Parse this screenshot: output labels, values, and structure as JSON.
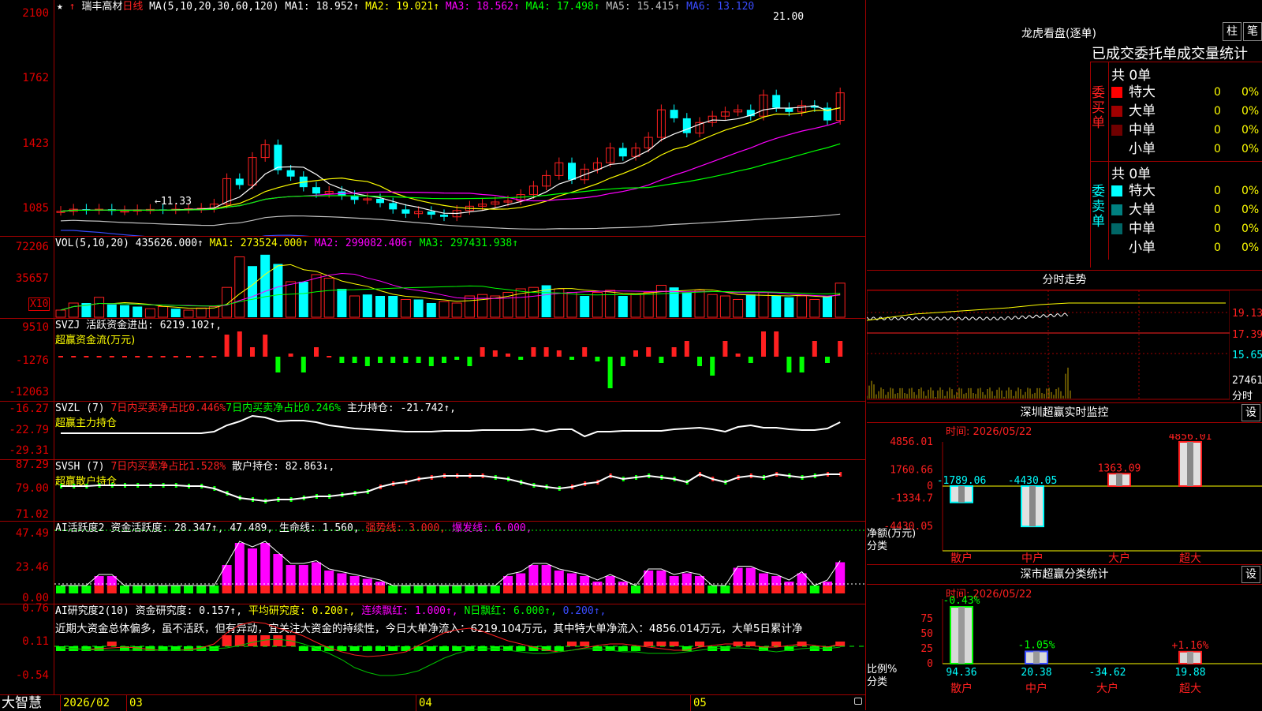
{
  "main": {
    "title": "瑞丰高材",
    "period": "日线",
    "ma_params": "MA(5,10,20,30,60,120)",
    "ma": [
      {
        "label": "MA1: 18.952↑",
        "color": "#ffffff"
      },
      {
        "label": "MA2: 19.021↑",
        "color": "#ffff00"
      },
      {
        "label": "MA3: 18.562↑",
        "color": "#ff00ff"
      },
      {
        "label": "MA4: 17.498↑",
        "color": "#00ff00"
      },
      {
        "label": "MA5: 15.415↑",
        "color": "#c0c0c0"
      },
      {
        "label": "MA6: 13.120",
        "color": "#3a4cff"
      }
    ],
    "y_ticks": [
      "2100",
      "1762",
      "1423",
      "1085"
    ],
    "high_label": "21.00",
    "low_label": "←11.33"
  },
  "vol": {
    "header": "VOL(5,10,20)",
    "value": "435626.000↑",
    "ma1": "MA1: 273524.000↑",
    "ma2": "MA2: 299082.406↑",
    "ma3": "MA3: 297431.938↑",
    "y_ticks": [
      "72206",
      "35657"
    ],
    "unit": "X10"
  },
  "svzj": {
    "header": "SVZJ  活跃资金进出: 6219.102↑,",
    "sub": "超赢资金流(万元)",
    "y_ticks": [
      "9510",
      "-1276",
      "-12063"
    ]
  },
  "svzl": {
    "name": "SVZL (7)",
    "a": "7日内买卖净占比0.446%",
    "b": "7日内买卖净占比0.246%",
    "c": "主力持仓: -21.742↑,",
    "sub": "超赢主力持仓",
    "y_ticks": [
      "-16.27",
      "-22.79",
      "-29.31"
    ]
  },
  "svsh": {
    "name": "SVSH (7)",
    "a": "7日内买卖净占比1.528%",
    "c": "散户持仓: 82.863↓,",
    "sub": "超赢散户持仓",
    "y_ticks": [
      "87.29",
      "79.00",
      "71.02"
    ]
  },
  "ai": {
    "name": "AI活跃度2",
    "a": "资金活跃度: 28.347↑,",
    "b": "47.489,",
    "c": "生命线: 1.560,",
    "d": "强势线: 3.000,",
    "e": "爆发线: 6.000,",
    "y_ticks": [
      "47.49",
      "23.46",
      "0.00"
    ]
  },
  "res": {
    "name": "AI研究度2(10)",
    "a": "资金研究度: 0.157↑,",
    "b": "平均研究度: 0.200↑,",
    "c": "连续飘红: 1.000↑,",
    "d": "N日飘红: 6.000↑,",
    "e": "0.200↑,",
    "text": "近期大资金总体偏多，虽不活跃，但有异动，宜关注大资金的持续性，今日大单净流入：6219.104万元，其中特大单净流入：4856.014万元，大单5日累计净",
    "y_ticks": [
      "0.76",
      "0.11",
      "-0.54"
    ]
  },
  "bottom": {
    "brand": "大智慧",
    "dates": [
      "2026/02",
      "03",
      "04",
      "05"
    ]
  },
  "right": {
    "title": "龙虎看盘(逐单)",
    "btn1": "柱",
    "btn2": "笔",
    "stats_title": "已成交委托单成交量统计",
    "buy_label": "委买单",
    "sell_label": "委卖单",
    "buy_total": "共 0单",
    "sell_total": "共 0单",
    "buy_rows": [
      {
        "name": "特大",
        "n": "0",
        "p": "0%",
        "color": "#ff0000"
      },
      {
        "name": "大单",
        "n": "0",
        "p": "0%",
        "color": "#a00000"
      },
      {
        "name": "中单",
        "n": "0",
        "p": "0%",
        "color": "#700000"
      },
      {
        "name": "小单",
        "n": "0",
        "p": "0%",
        "color": "#000000"
      }
    ],
    "sell_rows": [
      {
        "name": "特大",
        "n": "0",
        "p": "0%",
        "color": "#00ffff"
      },
      {
        "name": "大单",
        "n": "0",
        "p": "0%",
        "color": "#008080"
      },
      {
        "name": "中单",
        "n": "0",
        "p": "0%",
        "color": "#006666"
      },
      {
        "name": "小单",
        "n": "0",
        "p": "0%",
        "color": "#000000"
      }
    ],
    "intraday_title": "分时走势",
    "intraday_ticks": [
      "19.13",
      "17.39",
      "15.65",
      "27461",
      "分时"
    ],
    "sz_title": "深圳超赢实时监控",
    "sz_btn": "设",
    "sz_time": "时间: 2026/05/22",
    "sz_y": [
      "4856.01",
      "1760.66",
      "0",
      "-1334.7",
      "-4430.05"
    ],
    "sz_ylabel": "净额(万元)",
    "sz_xlabel": "分类",
    "sz_cats": [
      "散户",
      "中户",
      "大户",
      "超大"
    ],
    "sz_values": [
      -1789.06,
      -4430.05,
      1363.09,
      4856.01
    ],
    "sz_value_labels": [
      "-1789.06",
      "-4430.05",
      "1363.09",
      "4856.01"
    ],
    "fc_title": "深市超赢分类统计",
    "fc_btn": "设",
    "fc_time": "时间: 2026/05/22",
    "fc_y": [
      "75",
      "50",
      "25",
      "0"
    ],
    "fc_ylabel": "比例%",
    "fc_xlabel": "分类",
    "fc_cats": [
      "散户",
      "中户",
      "大户",
      "超大"
    ],
    "fc_bottom": [
      "94.36",
      "20.38",
      "-34.62",
      "19.88"
    ],
    "fc_top": [
      "-0.43%",
      "-1.05%",
      "",
      "+1.16%"
    ],
    "fc_values": [
      94.36,
      20.38,
      0,
      19.88
    ]
  }
}
